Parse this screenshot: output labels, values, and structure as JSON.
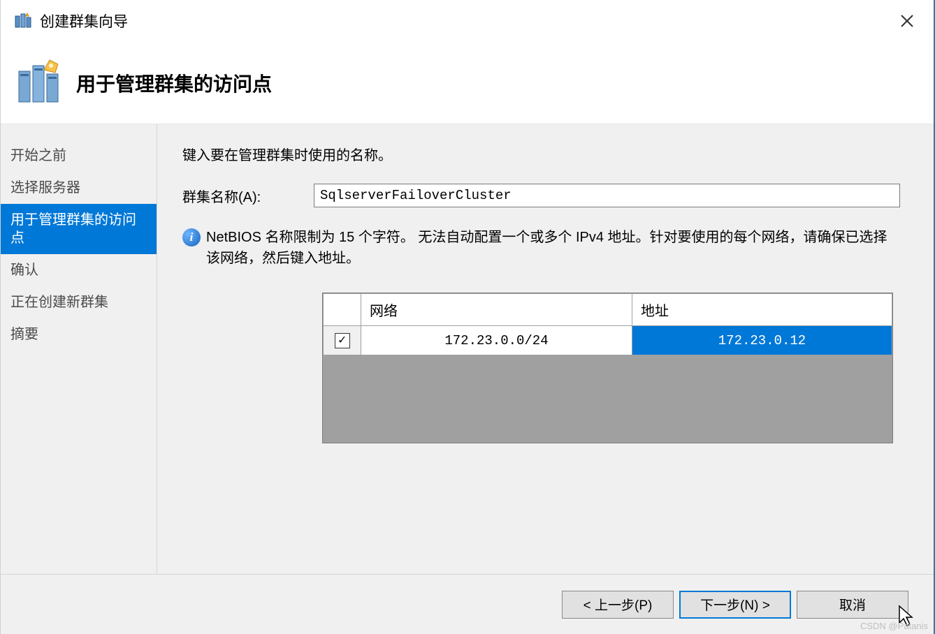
{
  "window": {
    "title": "创建群集向导"
  },
  "header": {
    "title": "用于管理群集的访问点"
  },
  "sidebar": {
    "items": [
      {
        "label": "开始之前",
        "selected": false
      },
      {
        "label": "选择服务器",
        "selected": false
      },
      {
        "label": "用于管理群集的访问点",
        "selected": true
      },
      {
        "label": "确认",
        "selected": false
      },
      {
        "label": "正在创建新群集",
        "selected": false
      },
      {
        "label": "摘要",
        "selected": false
      }
    ]
  },
  "content": {
    "instruction": "键入要在管理群集时使用的名称。",
    "cluster_name_label": "群集名称(A):",
    "cluster_name_value": "SqlserverFailoverCluster",
    "info_text": "NetBIOS 名称限制为 15 个字符。 无法自动配置一个或多个 IPv4 地址。针对要使用的每个网络，请确保已选择该网络，然后键入地址。",
    "table": {
      "headers": {
        "check": "",
        "network": "网络",
        "address": "地址"
      },
      "rows": [
        {
          "checked": true,
          "network": "172.23.0.0/24",
          "address": "172.23.0.12"
        }
      ]
    }
  },
  "footer": {
    "prev": "< 上一步(P)",
    "next": "下一步(N) >",
    "cancel": "取消"
  },
  "checkmark": "✓",
  "watermark": "CSDN @Patanis"
}
